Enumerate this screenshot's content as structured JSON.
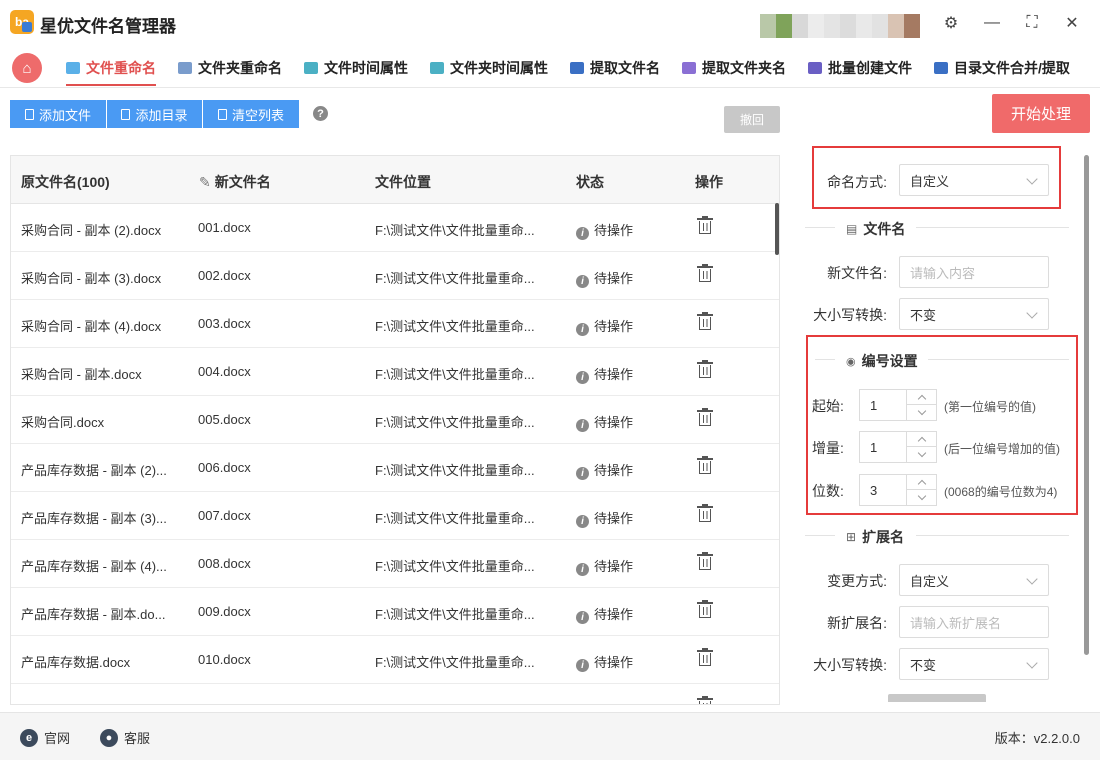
{
  "app": {
    "title": "星优文件名管理器",
    "logo_text": "ba"
  },
  "window_controls": {
    "settings": "⚙",
    "minimize": "—",
    "maximize": "⛶",
    "close": "✕"
  },
  "nav": {
    "home_icon": "home-icon",
    "tabs": [
      {
        "label": "文件重命名",
        "active": true
      },
      {
        "label": "文件夹重命名"
      },
      {
        "label": "文件时间属性"
      },
      {
        "label": "文件夹时间属性"
      },
      {
        "label": "提取文件名"
      },
      {
        "label": "提取文件夹名"
      },
      {
        "label": "批量创建文件"
      },
      {
        "label": "目录文件合并/提取"
      }
    ]
  },
  "toolbar": {
    "add_file": "添加文件",
    "add_dir": "添加目录",
    "clear_list": "清空列表",
    "help": "?",
    "undo": "撤回",
    "start": "开始处理"
  },
  "table": {
    "headers": {
      "orig": "原文件名(100)",
      "new": "新文件名",
      "location": "文件位置",
      "status": "状态",
      "action": "操作"
    },
    "rows": [
      {
        "orig": "采购合同 - 副本 (2).docx",
        "new": "001.docx",
        "location": "F:\\测试文件\\文件批量重命...",
        "status": "待操作"
      },
      {
        "orig": "采购合同 - 副本 (3).docx",
        "new": "002.docx",
        "location": "F:\\测试文件\\文件批量重命...",
        "status": "待操作"
      },
      {
        "orig": "采购合同 - 副本 (4).docx",
        "new": "003.docx",
        "location": "F:\\测试文件\\文件批量重命...",
        "status": "待操作"
      },
      {
        "orig": "采购合同 - 副本.docx",
        "new": "004.docx",
        "location": "F:\\测试文件\\文件批量重命...",
        "status": "待操作"
      },
      {
        "orig": "采购合同.docx",
        "new": "005.docx",
        "location": "F:\\测试文件\\文件批量重命...",
        "status": "待操作"
      },
      {
        "orig": "产品库存数据 - 副本 (2)...",
        "new": "006.docx",
        "location": "F:\\测试文件\\文件批量重命...",
        "status": "待操作"
      },
      {
        "orig": "产品库存数据 - 副本 (3)...",
        "new": "007.docx",
        "location": "F:\\测试文件\\文件批量重命...",
        "status": "待操作"
      },
      {
        "orig": "产品库存数据 - 副本 (4)...",
        "new": "008.docx",
        "location": "F:\\测试文件\\文件批量重命...",
        "status": "待操作"
      },
      {
        "orig": "产品库存数据 - 副本.do...",
        "new": "009.docx",
        "location": "F:\\测试文件\\文件批量重命...",
        "status": "待操作"
      },
      {
        "orig": "产品库存数据.docx",
        "new": "010.docx",
        "location": "F:\\测试文件\\文件批量重命...",
        "status": "待操作"
      }
    ]
  },
  "panel": {
    "naming_mode_label": "命名方式:",
    "naming_mode_value": "自定义",
    "filename_section": "文件名",
    "new_name_label": "新文件名:",
    "new_name_placeholder": "请输入内容",
    "case_label": "大小写转换:",
    "case_value": "不变",
    "numbering_section": "编号设置",
    "start_label": "起始:",
    "start_value": "1",
    "start_hint": "(第一位编号的值)",
    "step_label": "增量:",
    "step_value": "1",
    "step_hint": "(后一位编号增加的值)",
    "digits_label": "位数:",
    "digits_value": "3",
    "digits_hint": "(0068的编号位数为4)",
    "ext_section": "扩展名",
    "ext_mode_label": "变更方式:",
    "ext_mode_value": "自定义",
    "new_ext_label": "新扩展名:",
    "new_ext_placeholder": "请输入新扩展名",
    "ext_case_label": "大小写转换:",
    "ext_case_value": "不变"
  },
  "footer": {
    "website": "官网",
    "website_icon": "e",
    "support": "客服",
    "version": "版本：v2.2.0.0"
  },
  "colors": {
    "accent": "#e0504f",
    "primary": "#4a9af3",
    "start_btn": "#f06a6a",
    "highlight_box": "#e53b3b"
  }
}
